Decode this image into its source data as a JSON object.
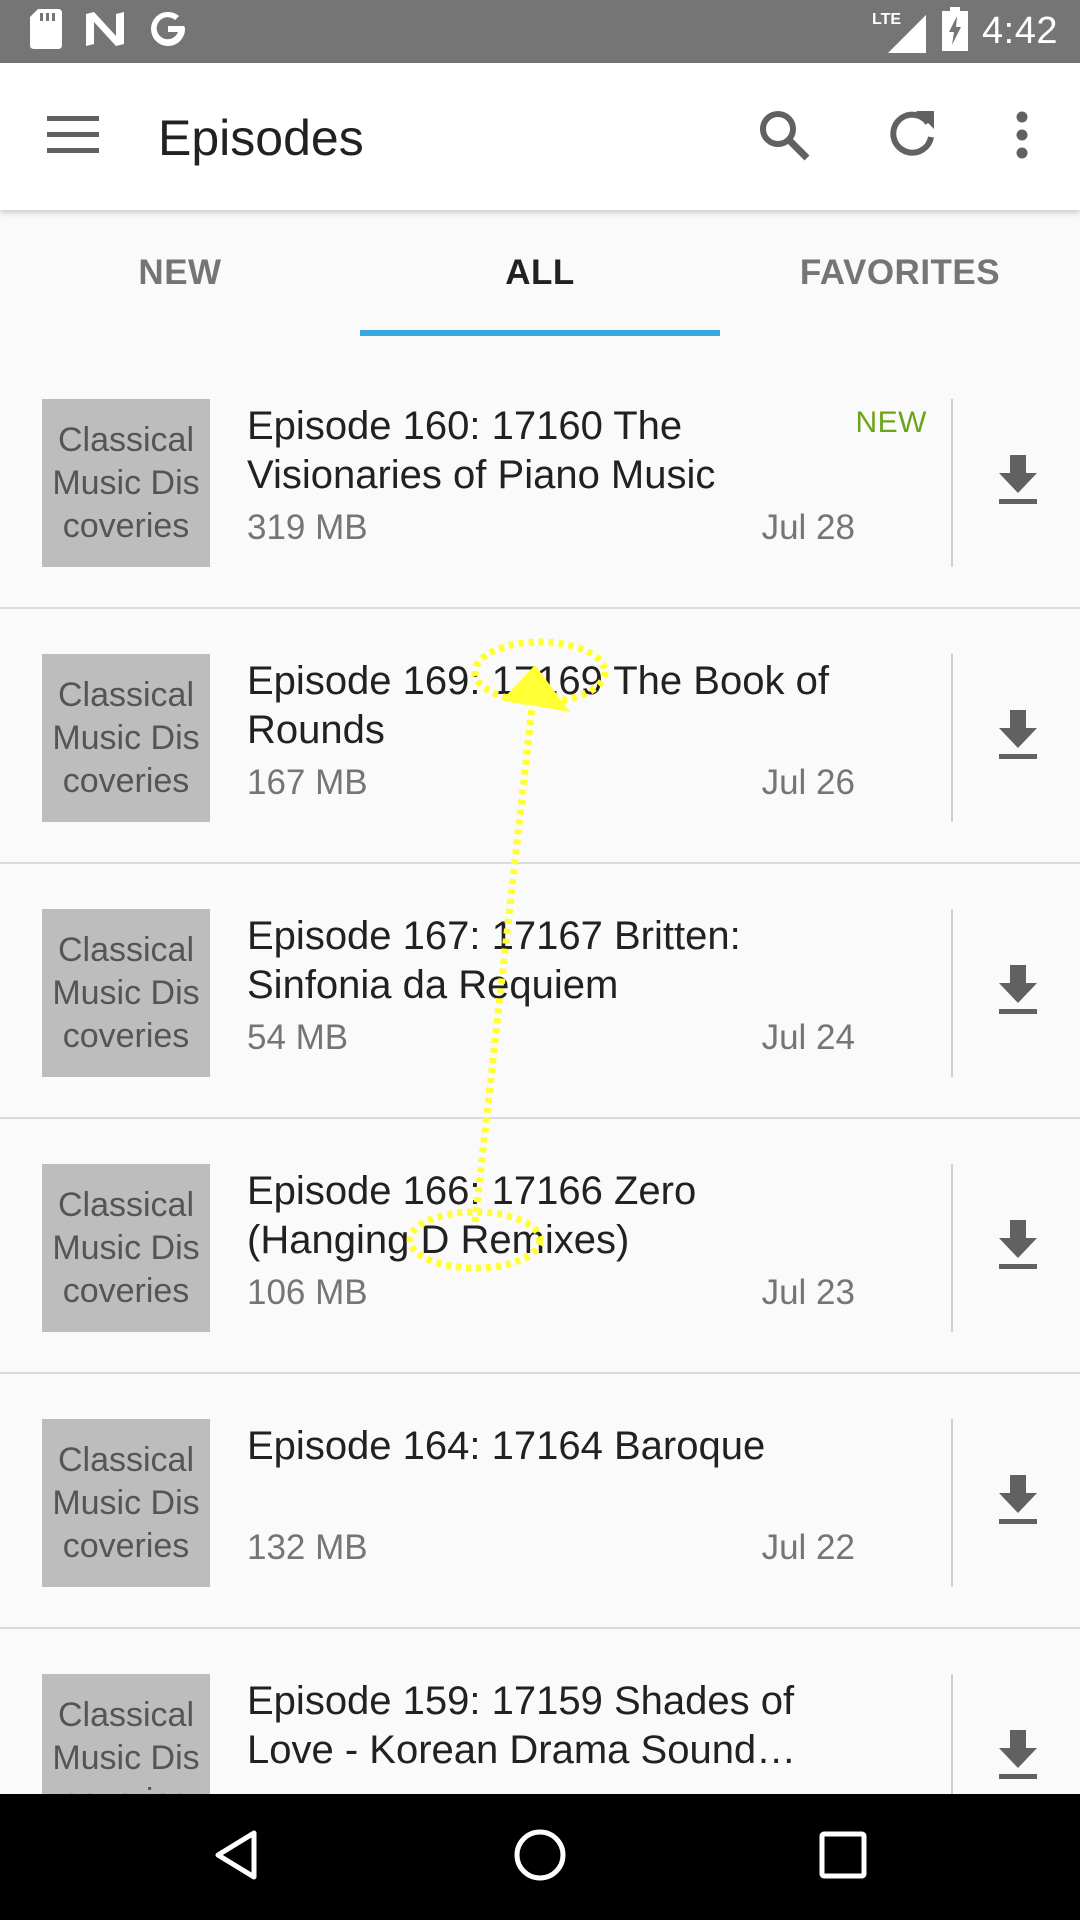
{
  "status_bar": {
    "time": "4:42",
    "network_label": "LTE",
    "icons": [
      "sd-card-icon",
      "n-logo-icon",
      "google-icon",
      "signal-icon",
      "battery-charging-icon"
    ]
  },
  "app_bar": {
    "title": "Episodes",
    "icons": [
      "menu-icon",
      "search-icon",
      "refresh-icon",
      "more-vert-icon"
    ]
  },
  "tabs": [
    {
      "label": "NEW",
      "active": false
    },
    {
      "label": "ALL",
      "active": true
    },
    {
      "label": "FAVORITES",
      "active": false
    }
  ],
  "episodes": [
    {
      "cover": "Classical Music Dis coveries",
      "title": "Episode 160: 17160 The Visionaries of Piano Music",
      "size": "319 MB",
      "date": "Jul 28",
      "badge": "NEW"
    },
    {
      "cover": "Classical Music Dis coveries",
      "title": "Episode 169: 17169 The Book of Rounds",
      "size": "167 MB",
      "date": "Jul 26",
      "badge": ""
    },
    {
      "cover": "Classical Music Dis coveries",
      "title": "Episode 167: 17167 Britten: Sinfonia da Requiem",
      "size": "54 MB",
      "date": "Jul 24",
      "badge": ""
    },
    {
      "cover": "Classical Music Dis coveries",
      "title": "Episode 166: 17166 Zero (Hanging D Remixes)",
      "size": "106 MB",
      "date": "Jul 23",
      "badge": ""
    },
    {
      "cover": "Classical Music Dis coveries",
      "title": "Episode 164: 17164 Baroque",
      "size": "132 MB",
      "date": "Jul 22",
      "badge": ""
    },
    {
      "cover": "Classical Music Dis coveries",
      "title": "Episode 159: 17159 Shades of Love - Korean Drama Sound…",
      "size": "",
      "date": "",
      "badge": ""
    }
  ],
  "colors": {
    "status_bar": "#757575",
    "tab_indicator": "#35a9e0",
    "new_badge": "#6ea41a",
    "gesture": "#ffff33"
  }
}
